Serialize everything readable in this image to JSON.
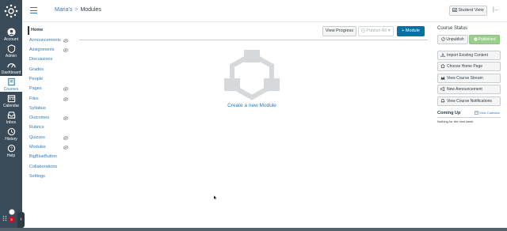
{
  "global_nav": {
    "items": [
      {
        "label": "Account",
        "icon": "account-icon"
      },
      {
        "label": "Admin",
        "icon": "admin-icon"
      },
      {
        "label": "Dashboard",
        "icon": "dashboard-icon"
      },
      {
        "label": "Courses",
        "icon": "courses-icon",
        "active": true
      },
      {
        "label": "Calendar",
        "icon": "calendar-icon"
      },
      {
        "label": "Inbox",
        "icon": "inbox-icon"
      },
      {
        "label": "History",
        "icon": "history-icon"
      },
      {
        "label": "Help",
        "icon": "help-icon"
      }
    ],
    "badge_count": "4"
  },
  "header": {
    "course_name": "Maria's",
    "separator": ">",
    "page": "Modules",
    "student_view_label": "Student View"
  },
  "course_nav": [
    {
      "label": "Home",
      "active": true,
      "hidden": false
    },
    {
      "label": "Announcements",
      "hidden": true
    },
    {
      "label": "Assignments",
      "hidden": true
    },
    {
      "label": "Discussions",
      "hidden": false
    },
    {
      "label": "Grades",
      "hidden": false
    },
    {
      "label": "People",
      "hidden": false
    },
    {
      "label": "Pages",
      "hidden": true
    },
    {
      "label": "Files",
      "hidden": true
    },
    {
      "label": "Syllabus",
      "hidden": false
    },
    {
      "label": "Outcomes",
      "hidden": true
    },
    {
      "label": "Rubrics",
      "hidden": false
    },
    {
      "label": "Quizzes",
      "hidden": true
    },
    {
      "label": "Modules",
      "hidden": true
    },
    {
      "label": "BigBlueButton",
      "hidden": false
    },
    {
      "label": "Collaborations",
      "hidden": false
    },
    {
      "label": "Settings",
      "hidden": false
    }
  ],
  "toolbar": {
    "view_progress": "View Progress",
    "publish_all": "Publish All",
    "add_module": "+ Module"
  },
  "empty_state": {
    "create_link": "Create a new Module"
  },
  "sidebar": {
    "course_status_title": "Course Status",
    "unpublish": "Unpublish",
    "published": "Published",
    "actions": [
      {
        "label": "Import Existing Content",
        "icon": "import-icon"
      },
      {
        "label": "Choose Home Page",
        "icon": "home-icon"
      },
      {
        "label": "View Course Stream",
        "icon": "stream-icon"
      },
      {
        "label": "New Announcement",
        "icon": "announcement-icon"
      },
      {
        "label": "View Course Notifications",
        "icon": "notification-icon"
      }
    ],
    "coming_up_title": "Coming Up",
    "view_calendar": "View Calendar",
    "nothing_text": "Nothing for the next week"
  },
  "colors": {
    "nav_bg": "#394b58",
    "link": "#2b7abc",
    "primary_button": "#0770a3",
    "published_green": "#9ccf8e"
  }
}
